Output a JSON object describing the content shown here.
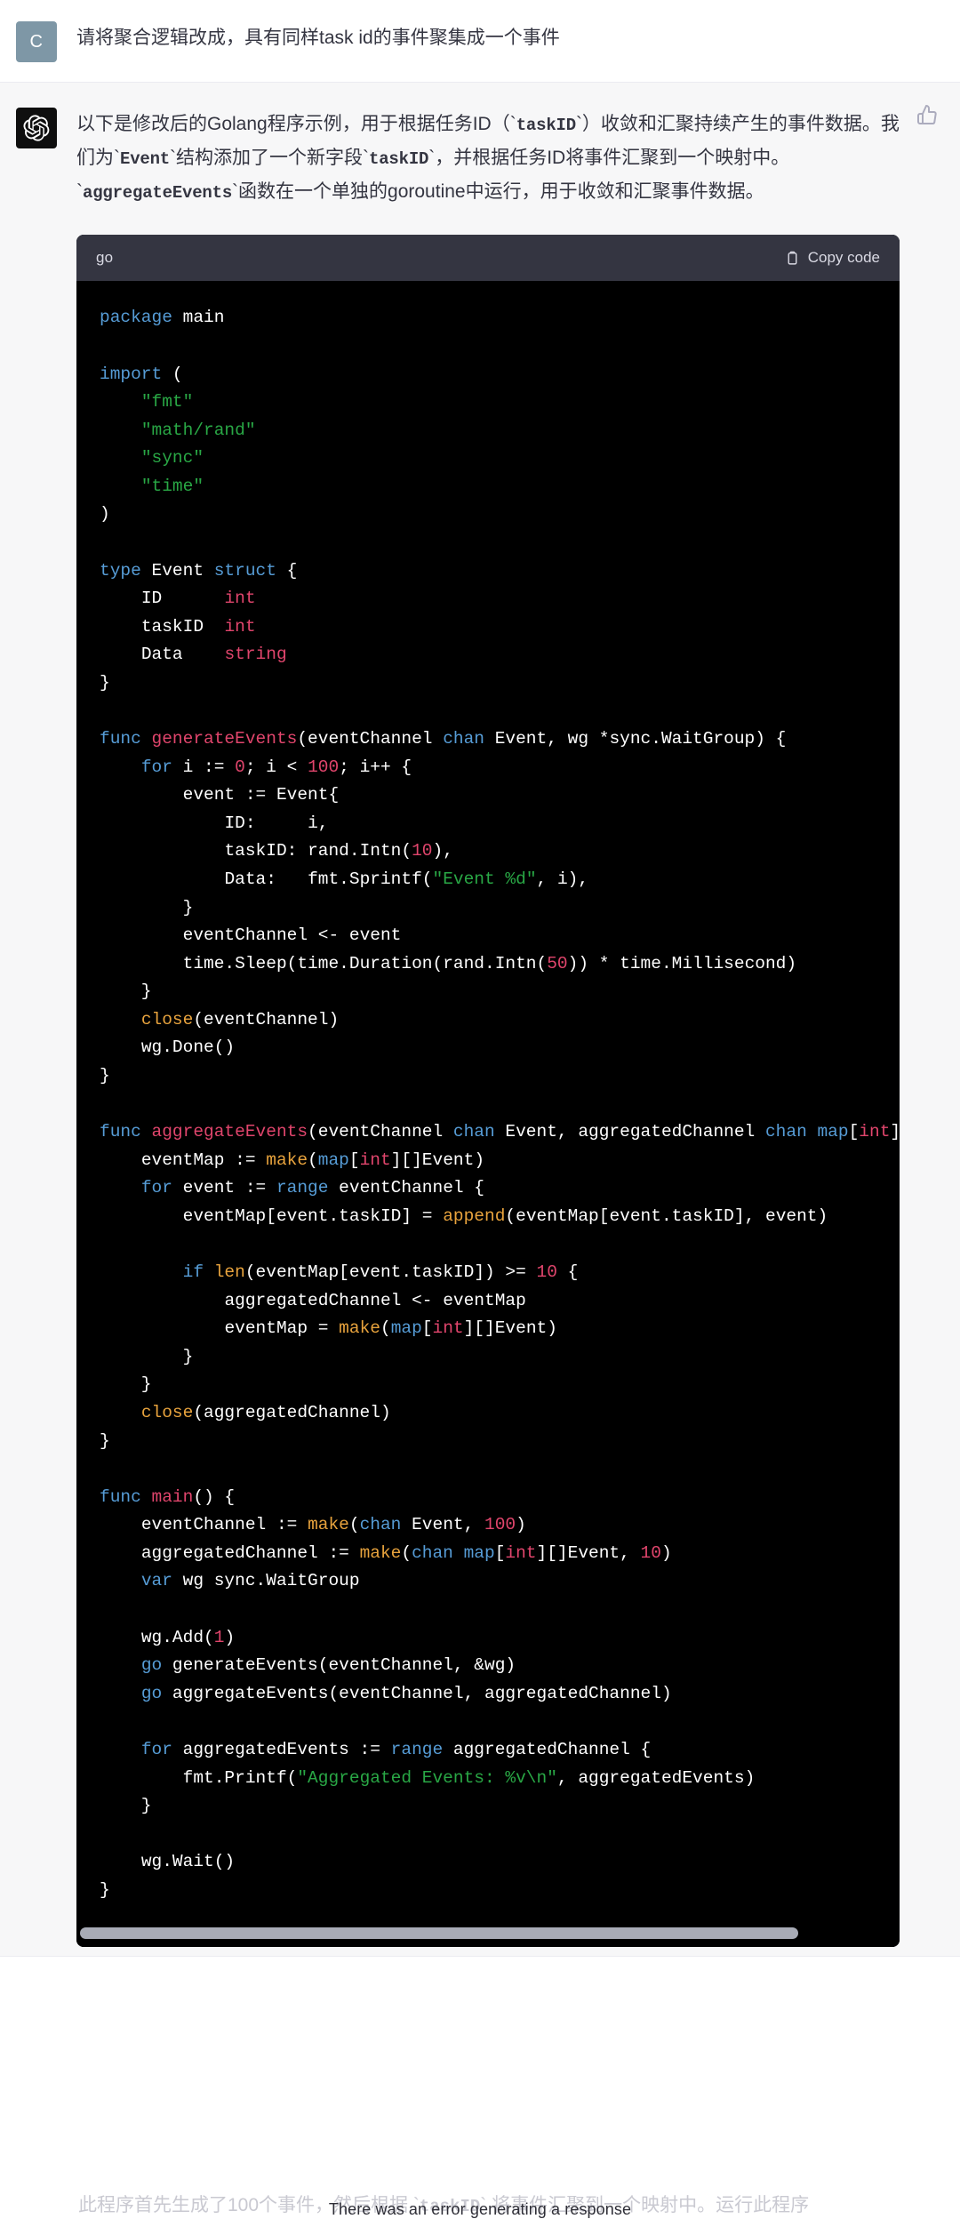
{
  "user_message": {
    "avatar_letter": "C",
    "text": "请将聚合逻辑改成，具有同样task id的事件聚集成一个事件"
  },
  "assistant_message": {
    "avatar_icon": "openai-logo-icon",
    "paragraph": {
      "seg1": "以下是修改后的Golang程序示例，用于根据任务ID（`",
      "code1": "taskID",
      "seg2": "`）收敛和汇聚持续产生的事件数据。我们为`",
      "code2": "Event",
      "seg3": "`结构添加了一个新字段`",
      "code3": "taskID",
      "seg4": "`，并根据任务ID将事件汇聚到一个映射中。`",
      "code4": "aggregateEvents",
      "seg5": "`函数在一个单独的goroutine中运行，用于收敛和汇聚事件数据。"
    },
    "feedback_icon": "thumbs-up-icon"
  },
  "code_block": {
    "language": "go",
    "copy_label": "Copy code",
    "copy_icon": "clipboard-icon",
    "scrollbar": "horizontal-scrollbar"
  },
  "tail": {
    "faded_text_a": "此程序首先生成了100个事件，然后根据 `",
    "faded_code": "taskID",
    "faded_text_b": "` 将事件汇聚到一个映射中。运行此程序",
    "error_message": "There was an error generating a response"
  },
  "colors": {
    "user_avatar_bg": "#7e97a6",
    "assistant_avatar_bg": "#0f0f0f",
    "assistant_row_bg": "#f7f7f8",
    "code_header_bg": "#343541",
    "code_body_bg": "#000000",
    "keyword": "#569cd6",
    "function": "#e0456c",
    "string": "#29a745",
    "number": "#e0456c",
    "builtin": "#e8a33d"
  }
}
